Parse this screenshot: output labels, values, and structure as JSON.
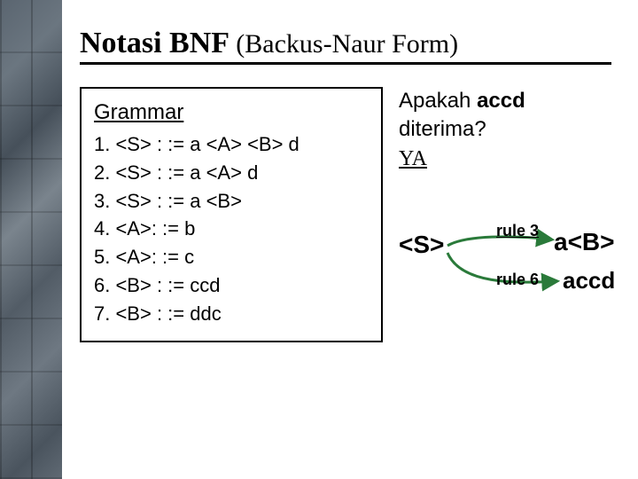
{
  "title_main": "Notasi BNF",
  "title_sub": "(Backus-Naur Form)",
  "grammar": {
    "heading": "Grammar",
    "rules": [
      "1. <S>  : := a <A> <B> d",
      "2. <S> : := a <A> d",
      "3. <S> : := a <B>",
      "4. <A>: := b",
      "5. <A>: := c",
      "6. <B> : := ccd",
      "7. <B> : := ddc"
    ]
  },
  "question": {
    "line1_prefix": "Apakah ",
    "line1_bold": "accd",
    "line1_suffix": " diterima?",
    "answer": "YA"
  },
  "derivation": {
    "start": "<S>",
    "step1_rule": "rule 3",
    "step1_result": "a<B>",
    "step2_rule": "rule 6",
    "step2_result": "accd"
  }
}
